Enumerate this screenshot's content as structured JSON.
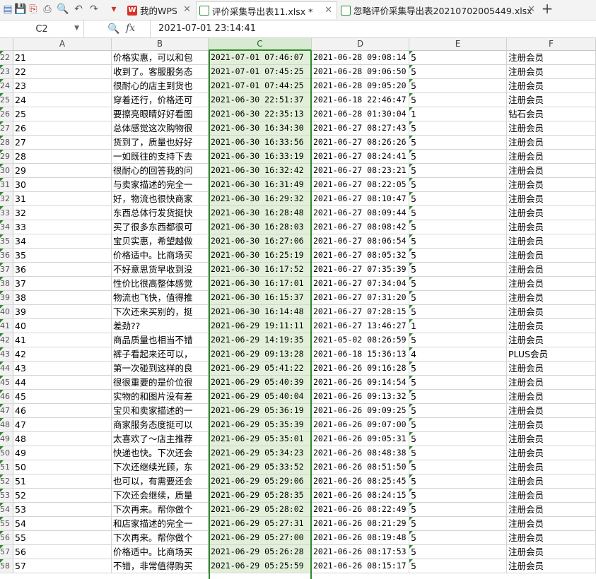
{
  "tabs": [
    {
      "label": "我的WPS",
      "icon": "wps-logo-icon"
    },
    {
      "label": "评价采集导出表11.xlsx *",
      "icon": "spreadsheet-icon"
    },
    {
      "label": "忽略评价采集导出表20210702005449.xlsx",
      "icon": "spreadsheet-icon"
    }
  ],
  "formula_bar": {
    "cell_ref": "C2",
    "fx": "fx",
    "value": "2021-07-01 23:14:41"
  },
  "columns": [
    "A",
    "B",
    "C",
    "D",
    "E",
    "F"
  ],
  "rows": [
    {
      "r": "22",
      "a": "21",
      "b": "价格实惠，可以和包",
      "c": "2021-07-01 07:46:07",
      "d": "2021-06-28 09:08:14",
      "e": "5",
      "f": "注册会员"
    },
    {
      "r": "23",
      "a": "22",
      "b": "收到了。客服服务态",
      "c": "2021-07-01 07:45:25",
      "d": "2021-06-28 09:06:50",
      "e": "5",
      "f": "注册会员"
    },
    {
      "r": "24",
      "a": "23",
      "b": "很耐心的店主到货也",
      "c": "2021-07-01 07:44:25",
      "d": "2021-06-28 09:05:20",
      "e": "5",
      "f": "注册会员"
    },
    {
      "r": "25",
      "a": "24",
      "b": "穿着还行，价格还可",
      "c": "2021-06-30 22:51:37",
      "d": "2021-06-18 22:46:47",
      "e": "5",
      "f": "注册会员"
    },
    {
      "r": "26",
      "a": "25",
      "b": "要擦亮眼睛好好看图",
      "c": "2021-06-30 22:35:13",
      "d": "2021-06-28 01:30:04",
      "e": "1",
      "f": "钻石会员"
    },
    {
      "r": "27",
      "a": "26",
      "b": "总体感觉这次购物很",
      "c": "2021-06-30 16:34:30",
      "d": "2021-06-27 08:27:43",
      "e": "5",
      "f": "注册会员"
    },
    {
      "r": "28",
      "a": "27",
      "b": "货到了，质量也好好",
      "c": "2021-06-30 16:33:56",
      "d": "2021-06-27 08:26:26",
      "e": "5",
      "f": "注册会员"
    },
    {
      "r": "29",
      "a": "28",
      "b": "一如既往的支持下去",
      "c": "2021-06-30 16:33:19",
      "d": "2021-06-27 08:24:41",
      "e": "5",
      "f": "注册会员"
    },
    {
      "r": "30",
      "a": "29",
      "b": "很耐心的回答我的问",
      "c": "2021-06-30 16:32:42",
      "d": "2021-06-27 08:23:21",
      "e": "5",
      "f": "注册会员"
    },
    {
      "r": "31",
      "a": "30",
      "b": "与卖家描述的完全一",
      "c": "2021-06-30 16:31:49",
      "d": "2021-06-27 08:22:05",
      "e": "5",
      "f": "注册会员"
    },
    {
      "r": "32",
      "a": "31",
      "b": "好，物流也很快商家",
      "c": "2021-06-30 16:29:32",
      "d": "2021-06-27 08:10:47",
      "e": "5",
      "f": "注册会员"
    },
    {
      "r": "33",
      "a": "32",
      "b": "东西总体行发货挺快",
      "c": "2021-06-30 16:28:48",
      "d": "2021-06-27 08:09:44",
      "e": "5",
      "f": "注册会员"
    },
    {
      "r": "34",
      "a": "33",
      "b": "买了很多东西都很可",
      "c": "2021-06-30 16:28:03",
      "d": "2021-06-27 08:08:42",
      "e": "5",
      "f": "注册会员"
    },
    {
      "r": "35",
      "a": "34",
      "b": "宝贝实惠，希望越做",
      "c": "2021-06-30 16:27:06",
      "d": "2021-06-27 08:06:54",
      "e": "5",
      "f": "注册会员"
    },
    {
      "r": "36",
      "a": "35",
      "b": "价格适中。比商场买",
      "c": "2021-06-30 16:25:19",
      "d": "2021-06-27 08:05:32",
      "e": "5",
      "f": "注册会员"
    },
    {
      "r": "37",
      "a": "36",
      "b": "不好意思货早收到没",
      "c": "2021-06-30 16:17:52",
      "d": "2021-06-27 07:35:39",
      "e": "5",
      "f": "注册会员"
    },
    {
      "r": "38",
      "a": "37",
      "b": "性价比很高整体感觉",
      "c": "2021-06-30 16:17:01",
      "d": "2021-06-27 07:34:04",
      "e": "5",
      "f": "注册会员"
    },
    {
      "r": "39",
      "a": "38",
      "b": "物流也飞快，值得推",
      "c": "2021-06-30 16:15:37",
      "d": "2021-06-27 07:31:20",
      "e": "5",
      "f": "注册会员"
    },
    {
      "r": "40",
      "a": "39",
      "b": "下次还来买别的，挺",
      "c": "2021-06-30 16:14:48",
      "d": "2021-06-27 07:28:15",
      "e": "5",
      "f": "注册会员"
    },
    {
      "r": "41",
      "a": "40",
      "b": "差劲??",
      "c": "2021-06-29 19:11:11",
      "d": "2021-06-27 13:46:27",
      "e": "1",
      "f": "注册会员"
    },
    {
      "r": "42",
      "a": "41",
      "b": "商品质量也相当不错",
      "c": "2021-06-29 14:19:35",
      "d": "2021-05-02 08:26:59",
      "e": "5",
      "f": "注册会员"
    },
    {
      "r": "43",
      "a": "42",
      "b": "裤子看起来还可以，",
      "c": "2021-06-29 09:13:28",
      "d": "2021-06-18 15:36:13",
      "e": "4",
      "f": "PLUS会员"
    },
    {
      "r": "44",
      "a": "43",
      "b": "第一次碰到这样的良",
      "c": "2021-06-29 05:41:22",
      "d": "2021-06-26 09:16:28",
      "e": "5",
      "f": "注册会员"
    },
    {
      "r": "45",
      "a": "44",
      "b": "很很重要的是价位很",
      "c": "2021-06-29 05:40:39",
      "d": "2021-06-26 09:14:54",
      "e": "5",
      "f": "注册会员"
    },
    {
      "r": "46",
      "a": "45",
      "b": "实物的和图片没有差",
      "c": "2021-06-29 05:40:04",
      "d": "2021-06-26 09:13:32",
      "e": "5",
      "f": "注册会员"
    },
    {
      "r": "47",
      "a": "46",
      "b": "宝贝和卖家描述的一",
      "c": "2021-06-29 05:36:19",
      "d": "2021-06-26 09:09:25",
      "e": "5",
      "f": "注册会员"
    },
    {
      "r": "48",
      "a": "47",
      "b": "商家服务态度挺可以",
      "c": "2021-06-29 05:35:39",
      "d": "2021-06-26 09:07:00",
      "e": "5",
      "f": "注册会员"
    },
    {
      "r": "49",
      "a": "48",
      "b": "太喜欢了～店主推荐",
      "c": "2021-06-29 05:35:01",
      "d": "2021-06-26 09:05:31",
      "e": "5",
      "f": "注册会员"
    },
    {
      "r": "50",
      "a": "49",
      "b": "快递也快。下次还会",
      "c": "2021-06-29 05:34:23",
      "d": "2021-06-26 08:48:38",
      "e": "5",
      "f": "注册会员"
    },
    {
      "r": "51",
      "a": "50",
      "b": "下次还继续光顾，东",
      "c": "2021-06-29 05:33:52",
      "d": "2021-06-26 08:51:50",
      "e": "5",
      "f": "注册会员"
    },
    {
      "r": "52",
      "a": "51",
      "b": "也可以，有需要还会",
      "c": "2021-06-29 05:29:06",
      "d": "2021-06-26 08:25:45",
      "e": "5",
      "f": "注册会员"
    },
    {
      "r": "53",
      "a": "52",
      "b": "下次还会继续，质量",
      "c": "2021-06-29 05:28:35",
      "d": "2021-06-26 08:24:15",
      "e": "5",
      "f": "注册会员"
    },
    {
      "r": "54",
      "a": "53",
      "b": "下次再来。帮你做个",
      "c": "2021-06-29 05:28:02",
      "d": "2021-06-26 08:22:49",
      "e": "5",
      "f": "注册会员"
    },
    {
      "r": "55",
      "a": "54",
      "b": "和店家描述的完全一",
      "c": "2021-06-29 05:27:31",
      "d": "2021-06-26 08:21:29",
      "e": "5",
      "f": "注册会员"
    },
    {
      "r": "56",
      "a": "55",
      "b": "下次再来。帮你做个",
      "c": "2021-06-29 05:27:00",
      "d": "2021-06-26 08:19:48",
      "e": "5",
      "f": "注册会员"
    },
    {
      "r": "57",
      "a": "56",
      "b": "价格适中。比商场买",
      "c": "2021-06-29 05:26:28",
      "d": "2021-06-26 08:17:53",
      "e": "5",
      "f": "注册会员"
    },
    {
      "r": "58",
      "a": "57",
      "b": "不错，非常值得购买",
      "c": "2021-06-29 05:25:59",
      "d": "2021-06-26 08:15:17",
      "e": "5",
      "f": "注册会员"
    }
  ]
}
